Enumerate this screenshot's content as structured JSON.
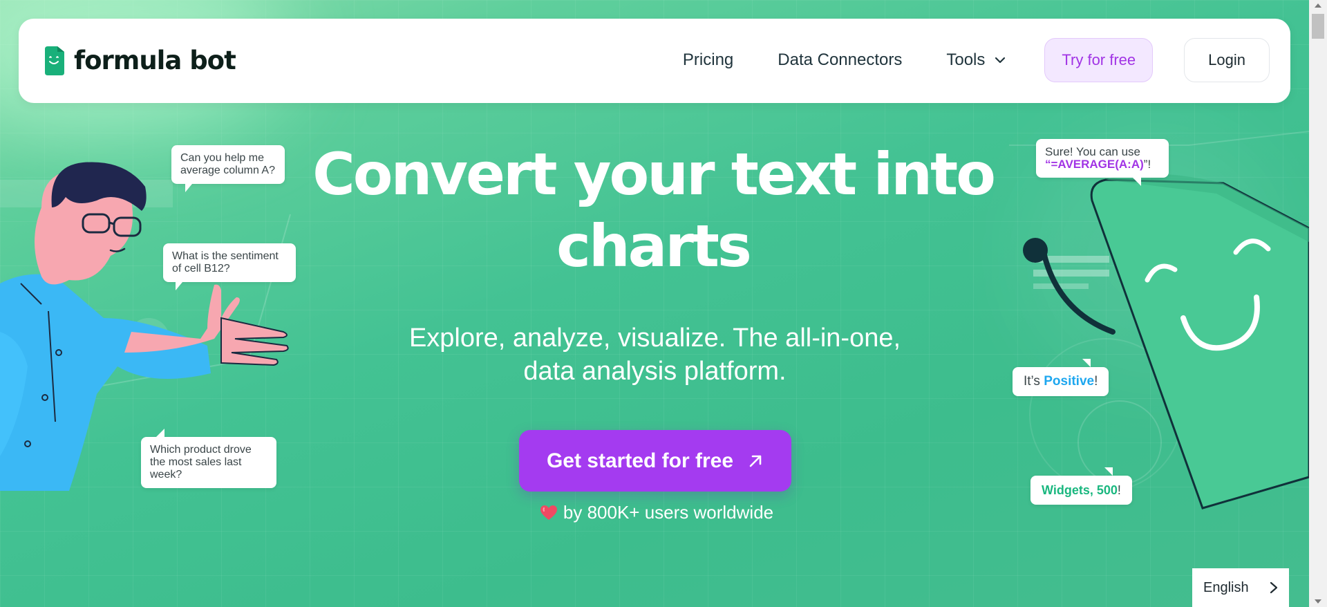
{
  "brand": {
    "name": "formula bot",
    "color": "#19b07a"
  },
  "nav": {
    "pricing": "Pricing",
    "connectors": "Data Connectors",
    "tools": "Tools",
    "try_free": "Try for free",
    "login": "Login"
  },
  "hero": {
    "title_line1": "Convert your text into",
    "title_line2": "charts",
    "subtitle_line1": "Explore, analyze, visualize. The all-in-one,",
    "subtitle_line2": "data analysis platform.",
    "cta": "Get started for free",
    "loved_text": "by 800K+ users worldwide"
  },
  "bubbles_left": {
    "b1_l1": "Can you help me",
    "b1_l2": "average column A?",
    "b2_l1": "What is the sentiment",
    "b2_l2": "of cell B12?",
    "b3_l1": "Which product drove",
    "b3_l2": "the most sales last",
    "b3_l3": "week?"
  },
  "bubbles_right": {
    "r1_l1": "Sure! You can use",
    "r1_q1": "“",
    "r1_formula": "=AVERAGE(A:A)",
    "r1_q2": "”!",
    "r2_pre": "It’s ",
    "r2_accent": "Positive",
    "r2_post": "!",
    "r3_accent": "Widgets, 500",
    "r3_post": "!"
  },
  "language": {
    "selected": "English"
  },
  "colors": {
    "accent_purple": "#a43bf0",
    "accent_blue": "#1ea7ef",
    "accent_green": "#1ab77f",
    "bg_green": "#43c293"
  }
}
